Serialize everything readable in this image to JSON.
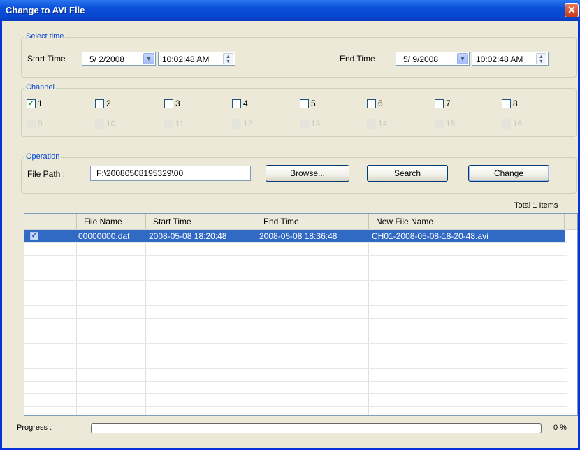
{
  "window": {
    "title": "Change to AVI File",
    "close_glyph": "✕"
  },
  "select_time": {
    "group_label": "Select time",
    "start_label": "Start Time",
    "start_date": "5/ 2/2008",
    "start_time": "10:02:48 AM",
    "end_label": "End Time",
    "end_date": "5/ 9/2008",
    "end_time": "10:02:48 AM"
  },
  "channel": {
    "group_label": "Channel",
    "items": [
      {
        "label": "1",
        "checked": true,
        "enabled": true
      },
      {
        "label": "2",
        "checked": false,
        "enabled": true
      },
      {
        "label": "3",
        "checked": false,
        "enabled": true
      },
      {
        "label": "4",
        "checked": false,
        "enabled": true
      },
      {
        "label": "5",
        "checked": false,
        "enabled": true
      },
      {
        "label": "6",
        "checked": false,
        "enabled": true
      },
      {
        "label": "7",
        "checked": false,
        "enabled": true
      },
      {
        "label": "8",
        "checked": false,
        "enabled": true
      },
      {
        "label": "9",
        "checked": false,
        "enabled": false
      },
      {
        "label": "10",
        "checked": false,
        "enabled": false
      },
      {
        "label": "11",
        "checked": false,
        "enabled": false
      },
      {
        "label": "12",
        "checked": false,
        "enabled": false
      },
      {
        "label": "13",
        "checked": false,
        "enabled": false
      },
      {
        "label": "14",
        "checked": false,
        "enabled": false
      },
      {
        "label": "15",
        "checked": false,
        "enabled": false
      },
      {
        "label": "16",
        "checked": false,
        "enabled": false
      }
    ]
  },
  "operation": {
    "group_label": "Operation",
    "file_path_label": "File Path :",
    "file_path_value": "F:\\20080508195329\\00",
    "browse_label": "Browse...",
    "search_label": "Search",
    "change_label": "Change"
  },
  "list": {
    "total_label": "Total 1 Items",
    "columns": [
      "",
      "File Name",
      "Start Time",
      "End Time",
      "New File Name"
    ],
    "rows": [
      {
        "checked": true,
        "file_name": "00000000.dat",
        "start_time": "2008-05-08 18:20:48",
        "end_time": "2008-05-08 18:36:48",
        "new_file_name": "CH01-2008-05-08-18-20-48.avi"
      }
    ]
  },
  "progress": {
    "label": "Progress :",
    "value": 0,
    "percent_text": "0 %"
  },
  "icons": {
    "dropdown": "chevron-down-icon",
    "spin": "spin-updown-icon",
    "check": "checkmark-icon"
  },
  "colors": {
    "title_bar": "#0a4fd8",
    "selection": "#316ac5",
    "group_label": "#0046d5"
  }
}
